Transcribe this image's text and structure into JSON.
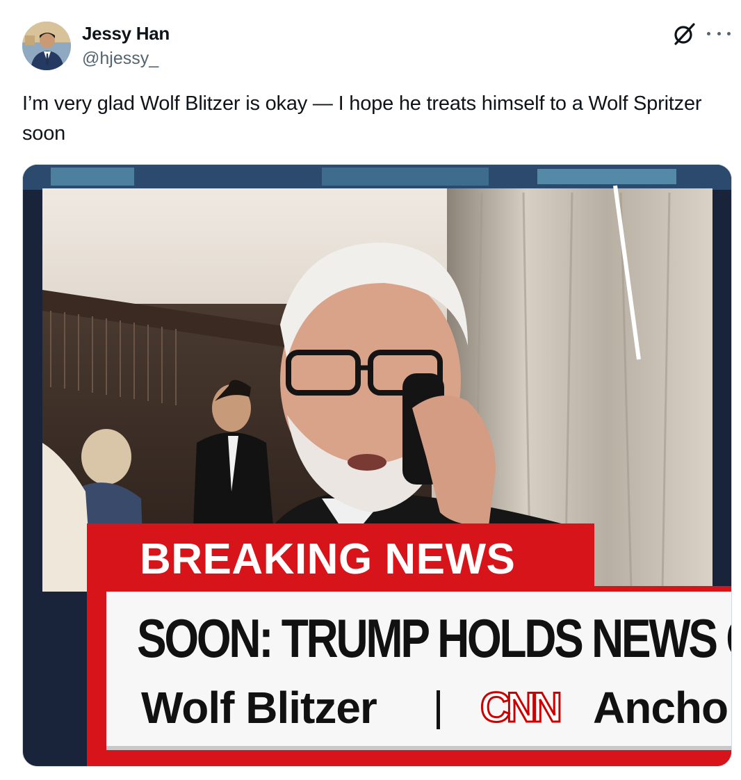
{
  "author": {
    "display_name": "Jessy Han",
    "handle": "@hjessy_"
  },
  "header_icons": [
    "grok-icon",
    "more-options-icon"
  ],
  "tweet": {
    "text": "I’m very glad Wolf Blitzer is okay — I hope he treats himself to a Wolf Spritzer soon"
  },
  "media": {
    "chyron": {
      "breaking_label": "BREAKING NEWS",
      "headline": "SOON: TRUMP HOLDS NEWS C",
      "anchor_name": "Wolf Blitzer",
      "network": "CNN",
      "role": "Ancho"
    }
  },
  "colors": {
    "breaking_red": "#d8141b",
    "text_primary": "#0f1419",
    "text_secondary": "#536471"
  }
}
